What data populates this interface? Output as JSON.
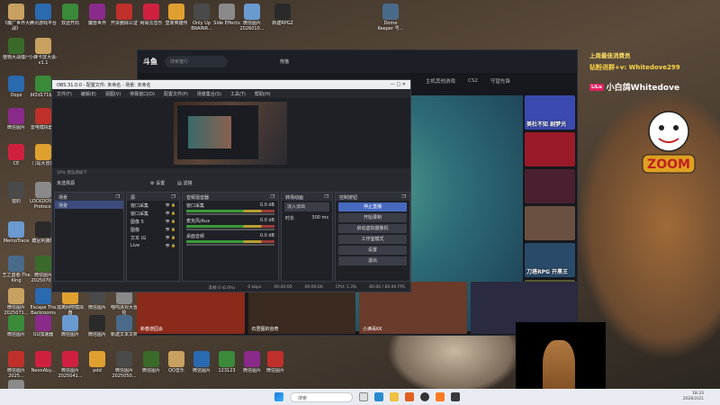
{
  "desktop": {
    "icons": [
      {
        "label": "《魔广世界大战》"
      },
      {
        "label": "腾讯游戏平台"
      },
      {
        "label": "双远开局"
      },
      {
        "label": "魔兽世界"
      },
      {
        "label": "开票删除公证"
      },
      {
        "label": "网易云音乐"
      },
      {
        "label": "皇家英雄传"
      },
      {
        "label": "Only Up BRAINR..."
      },
      {
        "label": "Side Effects"
      },
      {
        "label": "微信图片2026010..."
      },
      {
        "label": "新建RPG2"
      },
      {
        "label": "Dome Keeper 号..."
      },
      {
        "label": "植物大战僵尸"
      },
      {
        "label": "小蜂卡屏大会-v1.1"
      },
      {
        "label": "Oopz"
      },
      {
        "label": "bf2d171b..."
      },
      {
        "label": "微信图片"
      },
      {
        "label": "雷电模拟器9"
      },
      {
        "label": "CE"
      },
      {
        "label": "门站大冒险"
      },
      {
        "label": "猎豹"
      },
      {
        "label": "LOCKDOWN Protocol"
      },
      {
        "label": "MemoTrace"
      },
      {
        "label": "藏尼利捕快"
      },
      {
        "label": "王之盟者-The King"
      },
      {
        "label": "微信图片2025070..."
      },
      {
        "label": "微信图片2025071..."
      },
      {
        "label": "Escape The Backrooms"
      },
      {
        "label": "微信图片"
      },
      {
        "label": "UU加速器"
      },
      {
        "label": "微信图片2025..."
      },
      {
        "label": "NeonAby..."
      },
      {
        "label": "逃离网吧模拟器"
      },
      {
        "label": "微信图片"
      },
      {
        "label": "喵呜派对大冒险"
      },
      {
        "label": "微信图片"
      },
      {
        "label": "微信图片"
      },
      {
        "label": "新建文本文档"
      },
      {
        "label": "微信图片"
      },
      {
        "label": "QQ音乐"
      },
      {
        "label": "微信图片"
      },
      {
        "label": "123123"
      },
      {
        "label": "微信图片"
      },
      {
        "label": "微信图片"
      },
      {
        "label": "微信图片2025041..."
      },
      {
        "label": "pdd"
      },
      {
        "label": "微信图片2025050..."
      },
      {
        "label": "Q"
      },
      {
        "label": "微信图片2026-05..."
      },
      {
        "label": "微信图片"
      },
      {
        "label": "Cleverly Capyon..."
      },
      {
        "label": "PlantsVs..."
      },
      {
        "label": "Rec Center"
      },
      {
        "label": "Lilo's Bar..."
      },
      {
        "label": "Mira..."
      },
      {
        "label": "Fishing..."
      }
    ]
  },
  "douyu": {
    "logo": "斗鱼",
    "search_placeholder": "搜索猫行",
    "user_area": "熊猫",
    "nav_tabs": [
      "主机其他游戏",
      "CS2",
      "守望先锋"
    ],
    "recs": [
      {
        "text": "美杜不知 剧梦光",
        "color": "#3a4ab0"
      },
      {
        "text": "",
        "color": "#9a1a2a"
      },
      {
        "text": "",
        "color": "#4a2030"
      },
      {
        "text": "",
        "color": "#6a5040"
      },
      {
        "text": "刀塔RPG 开黑王",
        "color": "#2a4a6a"
      },
      {
        "text": "",
        "color": "#5a5a30"
      }
    ],
    "thumbs": [
      {
        "text": "新春游园会",
        "color": "#8a2a1a"
      },
      {
        "text": "石君图的创奇",
        "color": "#3a2a20"
      },
      {
        "text": "小满哥KK",
        "color": "#6a3a2a"
      },
      {
        "text": "",
        "color": "#2a2a40"
      }
    ]
  },
  "obs": {
    "title": "OBS 31.0.0 - 配置文件: 未命名 - 场景: 未命名",
    "title_controls": "— □ ✕",
    "menu": [
      "文件(F)",
      "编辑(E)",
      "视图(V)",
      "停靠窗口(D)",
      "配置文件(P)",
      "场景集合(S)",
      "工具(T)",
      "帮助(H)"
    ],
    "preview_scene": "10% 预览源如下",
    "tabs": {
      "source_label": "未选择源",
      "properties": "设置",
      "filters": "滤镜"
    },
    "scenes": {
      "header": "场景",
      "items": [
        "场景"
      ]
    },
    "sources": {
      "header": "源",
      "items": [
        "窗口采集",
        "窗口采集",
        "图像 5",
        "图像",
        "文本 (G",
        "Live"
      ]
    },
    "mixer": {
      "header": "音频混音器",
      "channels": [
        {
          "name": "窗口采集",
          "db": "0.0 dB"
        },
        {
          "name": "麦克风/Aux",
          "db": "0.0 dB"
        },
        {
          "name": "桌面音频",
          "db": "0.0 dB"
        }
      ]
    },
    "transitions": {
      "header": "转场动画",
      "type": "淡入淡出",
      "duration_label": "时长",
      "duration": "300 ms"
    },
    "controls": {
      "header": "控制按钮",
      "buttons": [
        "停止直播",
        "开始录制",
        "启动虚拟摄像机",
        "工作室模式",
        "设置",
        "退出"
      ]
    },
    "status": {
      "dropped": "丢帧 0 (0.0%)",
      "kbps": "0 kbps",
      "live_time": "00:00:00",
      "rec_time": "00:00:00",
      "cpu": "CPU: 1.3%",
      "fps": "60.00 / 60.00 FPS"
    }
  },
  "overlay": {
    "line1": "上周最佳消费员",
    "line2": "钻粉进群+v: Whitedove299",
    "line3": "小白鸽Whitedove",
    "tag": "LiLu",
    "sticker": "ZOOM"
  },
  "taskbar": {
    "search_placeholder": "搜索",
    "time": "18:33",
    "date": "2026/2/21"
  }
}
